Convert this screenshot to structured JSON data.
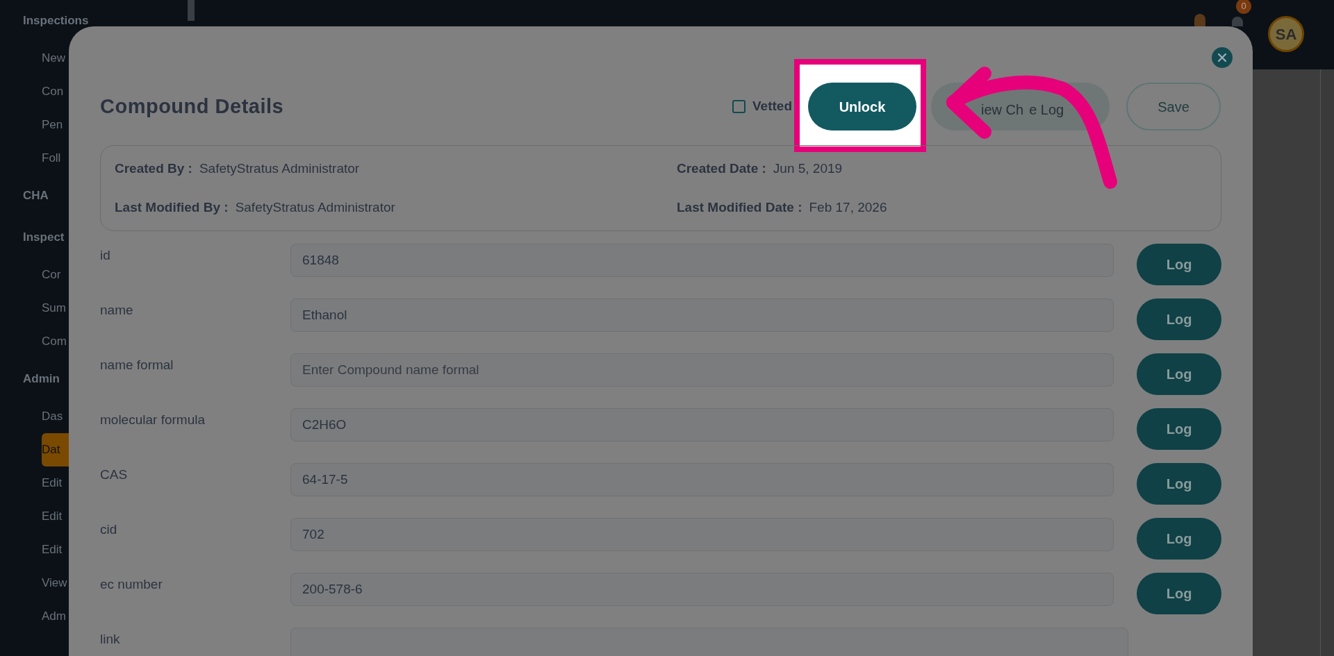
{
  "sidebar": {
    "items": [
      {
        "label": "Inspections",
        "kind": "heading"
      },
      {
        "label": "New",
        "kind": "item",
        "selected": false
      },
      {
        "label": "Con",
        "kind": "item",
        "selected": false
      },
      {
        "label": "Pen",
        "kind": "item",
        "selected": false
      },
      {
        "label": "Foll",
        "kind": "item",
        "selected": false
      },
      {
        "label": "CHA",
        "kind": "heading"
      },
      {
        "label": "Inspect",
        "kind": "heading"
      },
      {
        "label": "Cor",
        "kind": "item",
        "selected": false
      },
      {
        "label": "Sum",
        "kind": "item",
        "selected": false
      },
      {
        "label": "Com",
        "kind": "item",
        "selected": false
      },
      {
        "label": "Admin",
        "kind": "heading"
      },
      {
        "label": "Das",
        "kind": "item",
        "selected": false
      },
      {
        "label": "Dat",
        "kind": "item",
        "selected": true
      },
      {
        "label": "Edit",
        "kind": "item",
        "selected": false
      },
      {
        "label": "Edit",
        "kind": "item",
        "selected": false
      },
      {
        "label": "Edit",
        "kind": "item",
        "selected": false
      },
      {
        "label": "View",
        "kind": "item",
        "selected": false
      },
      {
        "label": "Adm",
        "kind": "item",
        "selected": false
      }
    ]
  },
  "topbar": {
    "notification_count": "0",
    "avatar": "SA"
  },
  "modal": {
    "title": "Compound Details",
    "vetted": {
      "label": "Vetted",
      "checked": false
    },
    "buttons": [
      {
        "label": "Unlock",
        "kind": "primary",
        "highlighted": true
      },
      {
        "label_parts": [
          "iew Ch",
          "e Log"
        ],
        "kind": "secondary",
        "highlighted": false
      },
      {
        "label": "Save",
        "kind": "outline",
        "highlighted": false
      }
    ],
    "info": [
      {
        "label": "Created By :",
        "value": "SafetyStratus Administrator"
      },
      {
        "label": "Created Date :",
        "value": "Jun 5, 2019"
      },
      {
        "label": "Last Modified By :",
        "value": "SafetyStratus Administrator"
      },
      {
        "label": "Last Modified Date :",
        "value": "Feb 17, 2026"
      }
    ],
    "fields": [
      {
        "label": "id",
        "value": "61848",
        "button": "Log"
      },
      {
        "label": "name",
        "value": "Ethanol",
        "button": "Log"
      },
      {
        "label": "name formal",
        "placeholder": "Enter Compound name formal",
        "button": "Log"
      },
      {
        "label": "molecular formula",
        "value": "C2H6O",
        "button": "Log"
      },
      {
        "label": "CAS",
        "value": "64-17-5",
        "button": "Log"
      },
      {
        "label": "cid",
        "value": "702",
        "button": "Log"
      },
      {
        "label": "ec number",
        "value": "200-578-6",
        "button": "Log"
      },
      {
        "label": "link"
      }
    ]
  }
}
